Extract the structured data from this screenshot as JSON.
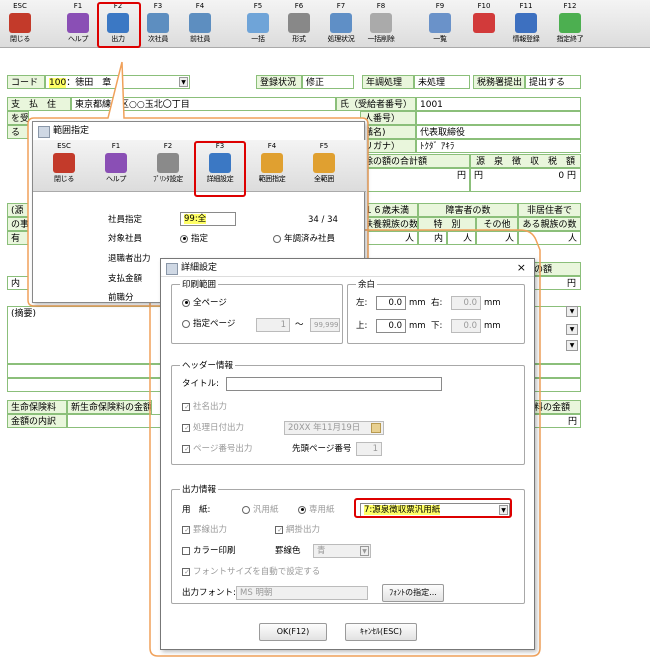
{
  "toolbar": {
    "keys": [
      {
        "key": "ESC",
        "label": "閉じる",
        "color": "#c33a2a"
      },
      {
        "key": "F1",
        "label": "ヘルプ",
        "color": "#8a4fb5"
      },
      {
        "key": "F2",
        "label": "出力",
        "color": "#3b78c4"
      },
      {
        "key": "F3",
        "label": "次社員",
        "color": "#5d8ec0"
      },
      {
        "key": "F4",
        "label": "前社員",
        "color": "#5d8ec0"
      },
      {
        "key": "F5",
        "label": "一括",
        "color": "#6fa4d8"
      },
      {
        "key": "F6",
        "label": "形式",
        "color": "#888888"
      },
      {
        "key": "F7",
        "label": "処理状況",
        "color": "#5f8fc6"
      },
      {
        "key": "F8",
        "label": "一括削除",
        "color": "#aaaaaa"
      },
      {
        "key": "F9",
        "label": "一覧",
        "color": "#6a92c9"
      },
      {
        "key": "F10",
        "label": "",
        "color": "#d23a3a"
      },
      {
        "key": "F11",
        "label": "情報登録",
        "color": "#3d70c0"
      },
      {
        "key": "F12",
        "label": "指定終了",
        "color": "#4caf50"
      }
    ]
  },
  "main": {
    "code_label": "コード",
    "code_value": "100",
    "code_name": "徳田　章",
    "reg_status_label": "登録状況",
    "reg_status": "修正",
    "nencho_label": "年調処理",
    "nencho": "未処理",
    "tax_label": "税務署提出",
    "tax": "提出する",
    "pay_label": "支　払　住",
    "pay_suffix": "を受",
    "ru": "る",
    "address": "東京都練馬区○○玉北〇丁目",
    "name_label": "氏（受給者番号）",
    "recipient_no": "1001",
    "person_no_label": "人番号）",
    "title_label": "職名)",
    "title_value": "代表取締役",
    "kana_label": "リガナ）",
    "kana_value": "ﾄｸﾀﾞ ｱｷﾗ",
    "deduct_label": "除の額の合計額",
    "withhold_label": "源　泉　徴　収　税　額",
    "yen1": "円",
    "yen2": "円",
    "zero": "0 円",
    "source_label": "(源",
    "ga": "の事",
    "u16_label": "１６歳未満",
    "dep_label": "扶養親族の数",
    "disab_label": "障害者の数",
    "special": "特　別",
    "other": "その他",
    "nonres_label": "非居住者で",
    "nonres2": "ある親族の数",
    "person": "人",
    "has": "有",
    "uchi": "内",
    "kingaku": "の額",
    "yen3": "円",
    "tekiyo": "(摘要)",
    "life_label": "生命保険料",
    "new_life": "新生命保険料の金額",
    "life_amt": "料の金額",
    "breakdown": "金額の内訳",
    "yen4": "円"
  },
  "range_dialog": {
    "title": "範囲指定",
    "keys": [
      {
        "key": "ESC",
        "label": "閉じる"
      },
      {
        "key": "F1",
        "label": "ヘルプ"
      },
      {
        "key": "F2",
        "label": "ﾌﾟﾘﾝﾀ設定"
      },
      {
        "key": "F3",
        "label": "詳細設定"
      },
      {
        "key": "F4",
        "label": "範囲指定"
      },
      {
        "key": "F5",
        "label": "全範囲"
      }
    ],
    "emp_label": "社員指定",
    "emp_value": "99:全",
    "count": "34 / 34",
    "target_label": "対象社員",
    "target_opt1": "指定",
    "target_opt2": "年調済み社員",
    "retired_label": "退職者出力",
    "pay_label": "支払金額",
    "other_label": "前職分"
  },
  "detail_dialog": {
    "title": "詳細設定",
    "close": "×",
    "print_range": "印刷範囲",
    "all_pages": "全ページ",
    "spec_pages": "指定ページ",
    "page_from": "1",
    "tilde": "〜",
    "page_to": "99,999",
    "margin": "余白",
    "left": "左:",
    "right": "右:",
    "top": "上:",
    "bottom": "下:",
    "m_left": "0.0",
    "m_right": "0.0",
    "m_top": "0.0",
    "m_bottom": "0.0",
    "mm": "mm",
    "header": "ヘッダー情報",
    "title_label": "タイトル:",
    "company_out": "社名出力",
    "date_out": "処理日付出力",
    "date_value": "20XX 年11月19日",
    "page_out": "ページ番号出力",
    "first_page": "先頭ページ番号",
    "first_page_val": "1",
    "output": "出力情報",
    "paper": "用　紙:",
    "paper_general": "汎用紙",
    "paper_dedicated": "専用紙",
    "paper_value": "7:源泉徴収票汎用紙",
    "border_out": "罫線出力",
    "shade_out": "網掛出力",
    "color_print": "カラー印刷",
    "line_color": "罫線色",
    "line_color_value": "青",
    "auto_font": "フォントサイズを自動で設定する",
    "font_label": "出力フォント:",
    "font_value": "MS 明朝",
    "font_btn": "ﾌｫﾝﾄの指定...",
    "ok": "OK(F12)",
    "cancel": "ｷｬﾝｾﾙ(ESC)"
  }
}
